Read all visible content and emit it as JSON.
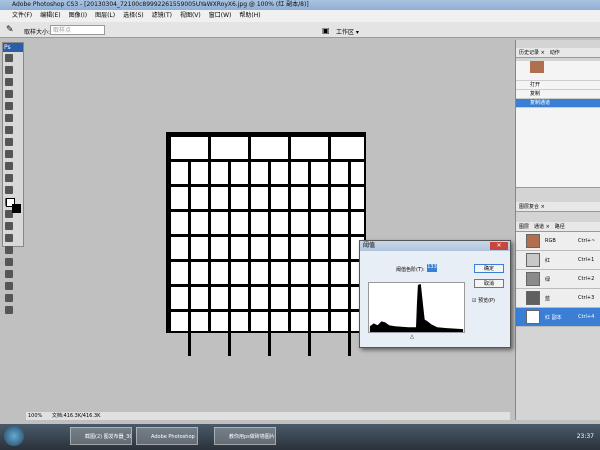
{
  "window": {
    "title": "Adobe Photoshop CS3 - [20130304_72100c89992261559005UYaWXRoyX6.jpg @ 100% (红 副本/8)]"
  },
  "menu": [
    "文件(F)",
    "编辑(E)",
    "图像(I)",
    "图层(L)",
    "选择(S)",
    "滤镜(T)",
    "视图(V)",
    "窗口(W)",
    "帮助(H)"
  ],
  "options": {
    "sample_label": "取样大小:",
    "sample_value": "取样点",
    "workspace": "工作区 ▾"
  },
  "history": {
    "tabs": [
      "历史记录 ×",
      "动作"
    ],
    "items": [
      "打开",
      "复制",
      "复制通道"
    ],
    "selected": 2
  },
  "channels": {
    "tabs_top": [
      "图层复合 ×"
    ],
    "tabs": [
      "图层",
      "通道 ×",
      "路径"
    ],
    "rows": [
      {
        "name": "RGB",
        "key": "Ctrl+~",
        "color": "#b07050"
      },
      {
        "name": "红",
        "key": "Ctrl+1",
        "color": "#c8c8c8"
      },
      {
        "name": "绿",
        "key": "Ctrl+2",
        "color": "#8a8a8a"
      },
      {
        "name": "蓝",
        "key": "Ctrl+3",
        "color": "#606060"
      },
      {
        "name": "红 副本",
        "key": "Ctrl+4",
        "color": "#ffffff"
      }
    ],
    "selected": 4
  },
  "dialog": {
    "title": "阈值",
    "level_label": "阈值色阶(T):",
    "level_value": "133",
    "ok": "确定",
    "cancel": "取消",
    "preview": "预览(P)",
    "preview_checked": true
  },
  "status": {
    "zoom": "100%",
    "doc": "文档:416.3K/416.3K"
  },
  "taskbar": {
    "tasks": [
      "截图(2) 图发布器_30...",
      "Adobe Photoshop ...",
      "教你用ps做砖墙图片..."
    ],
    "clock": "23:37"
  }
}
